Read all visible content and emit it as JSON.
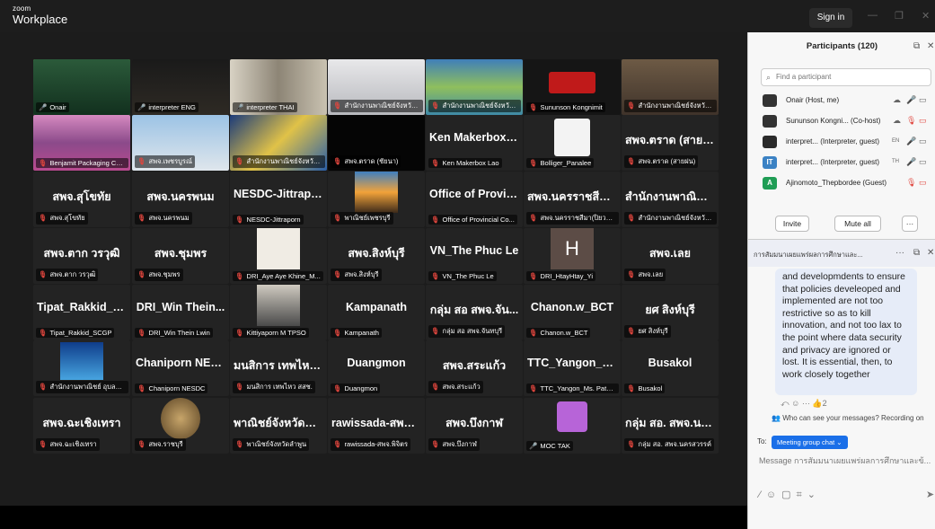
{
  "app": {
    "brand_small": "zoom",
    "brand_name": "Workplace",
    "signin": "Sign in"
  },
  "colors": {
    "active_speaker": "#7ac943",
    "muted": "#e0463e",
    "accent": "#1a6fe8"
  },
  "tiles": [
    {
      "big": "",
      "cap": "Onair",
      "muted": false,
      "pic": "speaker"
    },
    {
      "big": "",
      "cap": "interpreter ENG",
      "muted": false,
      "pic": "dark"
    },
    {
      "big": "",
      "cap": "interpreter THAI",
      "muted": false,
      "pic": "room"
    },
    {
      "big": "",
      "cap": "สำนักงานพาณิชย์จังหวัดสุ...",
      "muted": true,
      "pic": "office"
    },
    {
      "big": "",
      "cap": "สำนักงานพาณิชย์จังหวัดหน...",
      "muted": true,
      "pic": "landscape"
    },
    {
      "big": "",
      "cap": "Sununson Kongnimit",
      "muted": true,
      "pic": "logo"
    },
    {
      "big": "",
      "cap": "สำนักงานพาณิชย์จังหวัดสุ...",
      "muted": true,
      "pic": "office2"
    },
    {
      "big": "",
      "cap": "Benjamit Packaging Co., Lt...",
      "muted": true,
      "pic": "flowers"
    },
    {
      "big": "",
      "cap": "สพจ.เพชรบูรณ์",
      "muted": true,
      "pic": "building"
    },
    {
      "big": "",
      "cap": "สำนักงานพาณิชย์จังหวัดประจวบ...",
      "muted": true,
      "pic": "starry"
    },
    {
      "big": "",
      "cap": "สพจ.ตราด (ชัยนา)",
      "muted": true,
      "pic": "black"
    },
    {
      "big": "Ken Makerbox L...",
      "cap": "Ken Makerbox Lao",
      "muted": true,
      "pic": ""
    },
    {
      "big": "",
      "cap": "Bolliger_Panalee",
      "muted": true,
      "pic": "woman"
    },
    {
      "big": "สพจ.ตราด (สายฝน)",
      "cap": "สพจ.ตราด (สายฝน)",
      "muted": true,
      "pic": ""
    },
    {
      "big": "สพจ.สุโขทัย",
      "cap": "สพจ.สุโขทัย",
      "muted": true,
      "pic": ""
    },
    {
      "big": "สพจ.นครพนม",
      "cap": "สพจ.นครพนม",
      "muted": true,
      "pic": ""
    },
    {
      "big": "NESDC-Jittraporn",
      "cap": "NESDC-Jittraporn",
      "muted": true,
      "pic": ""
    },
    {
      "big": "",
      "cap": "พาณิชย์เพชรบุรี",
      "muted": true,
      "pic": "sunset"
    },
    {
      "big": "Office of Provin...",
      "cap": "Office of Provincial Co...",
      "muted": true,
      "pic": ""
    },
    {
      "big": "สพจ.นครราชสีมา...",
      "cap": "สพจ.นครราชสีมา(ปิยวรรณ)",
      "muted": true,
      "pic": ""
    },
    {
      "big": "สำนักงานพาณิชย์...",
      "cap": "สำนักงานพาณิชย์จังหวัด...",
      "muted": true,
      "pic": ""
    },
    {
      "big": "สพจ.ตาก วรวุฒิ",
      "cap": "สพจ.ตาก วรวุฒิ",
      "muted": true,
      "pic": ""
    },
    {
      "big": "สพจ.ชุมพร",
      "cap": "สพจ.ชุมพร",
      "muted": true,
      "pic": ""
    },
    {
      "big": "",
      "cap": "DRI_Aye Aye Khine_M...",
      "muted": true,
      "pic": "plant"
    },
    {
      "big": "สพจ.สิงห์บุรี",
      "cap": "สพจ.สิงห์บุรี",
      "muted": true,
      "pic": ""
    },
    {
      "big": "VN_The Phuc Le",
      "cap": "VN_The Phuc Le",
      "muted": true,
      "pic": ""
    },
    {
      "big": "",
      "cap": "DRI_HtayHtay_Yi",
      "muted": true,
      "pic": "avatarH"
    },
    {
      "big": "สพจ.เลย",
      "cap": "สพจ.เลย",
      "muted": true,
      "pic": ""
    },
    {
      "big": "Tipat_Rakkid_SC...",
      "cap": "Tipat_Rakkid_SCGP",
      "muted": true,
      "pic": ""
    },
    {
      "big": "DRI_Win Thein...",
      "cap": "DRI_Win Thein Lwin",
      "muted": true,
      "pic": ""
    },
    {
      "big": "",
      "cap": "Kittiyaporn M TPSO",
      "muted": true,
      "pic": "person"
    },
    {
      "big": "Kampanath",
      "cap": "Kampanath",
      "muted": true,
      "pic": ""
    },
    {
      "big": "กลุ่ม สอ สพจ.จัน...",
      "cap": "กลุ่ม สอ สพจ.จันทบุรี",
      "muted": true,
      "pic": ""
    },
    {
      "big": "Chanon.w_BCT",
      "cap": "Chanon.w_BCT",
      "muted": true,
      "pic": ""
    },
    {
      "big": "ยศ สิงห์บุรี",
      "cap": "ยศ สิงห์บุรี",
      "muted": true,
      "pic": ""
    },
    {
      "big": "",
      "cap": "สำนักงานพาณิชย์ อุบลราชธานี",
      "muted": true,
      "pic": "emblem"
    },
    {
      "big": "Chaniporn NESDC",
      "cap": "Chaniporn NESDC",
      "muted": true,
      "pic": ""
    },
    {
      "big": "มนสิการ เทพไหว...",
      "cap": "มนสิการ เทพไหว สสช.",
      "muted": true,
      "pic": ""
    },
    {
      "big": "Duangmon",
      "cap": "Duangmon",
      "muted": true,
      "pic": ""
    },
    {
      "big": "สพจ.สระแก้ว",
      "cap": "สพจ.สระแก้ว",
      "muted": true,
      "pic": ""
    },
    {
      "big": "TTC_Yangon_Ms...",
      "cap": "TTC_Yangon_Ms. Patch...",
      "muted": true,
      "pic": ""
    },
    {
      "big": "Busakol",
      "cap": "Busakol",
      "muted": true,
      "pic": ""
    },
    {
      "big": "สพจ.ฉะเชิงเทรา",
      "cap": "สพจ.ฉะเชิงเทรา",
      "muted": true,
      "pic": ""
    },
    {
      "big": "",
      "cap": "สพจ.ราชบุรี",
      "muted": true,
      "pic": "seal"
    },
    {
      "big": "พาณิชย์จังหวัดลำ...",
      "cap": "พาณิชย์จังหวัดลำพูน",
      "muted": true,
      "pic": ""
    },
    {
      "big": "rawissada-สพจ....",
      "cap": "rawissada-สพจ.พิจิตร",
      "muted": true,
      "pic": ""
    },
    {
      "big": "สพจ.บึงกาฬ",
      "cap": "สพจ.บึงกาฬ",
      "muted": true,
      "pic": ""
    },
    {
      "big": "",
      "cap": "MOC TAK",
      "muted": false,
      "pic": "avatarP"
    },
    {
      "big": "กลุ่ม สอ. สพจ.นค...",
      "cap": "กลุ่ม สอ. สพจ.นครสวรรค์",
      "muted": true,
      "pic": ""
    }
  ],
  "participants": {
    "title": "Participants (120)",
    "search_placeholder": "Find a participant",
    "rows": [
      {
        "name": "Onair (Host, me)",
        "avatar": "",
        "color": "#333"
      },
      {
        "name": "Sununson Kongni... (Co-host)",
        "avatar": "",
        "color": "#333"
      },
      {
        "name": "interpret... (Interpreter, guest)",
        "badge": "EN",
        "avatar": "",
        "color": "#2a2a2a"
      },
      {
        "name": "interpret... (Interpreter, guest)",
        "badge": "TH",
        "avatar": "IT",
        "color": "#3b82c4"
      },
      {
        "name": "Ajinomoto_Thepbordee (Guest)",
        "avatar": "A",
        "color": "#1f9d55"
      }
    ],
    "invite": "Invite",
    "mute_all": "Mute all",
    "more": "···"
  },
  "chat": {
    "title": "การสัมมนาเผยแพร่ผลการศึกษาและ...",
    "message": "and developmdents to ensure that policies develeoped and implemented are not too restrictive so as to kill innovation, and not too lax to the point where data security and privacy are ignored or lost.  It is essential, then, to work closely together",
    "reaction_count": "2",
    "who_can_see": "Who can see your messages? Recording on",
    "to_label": "To:",
    "to_target": "Meeting group chat ⌄",
    "input_placeholder": "Message การสัมมนาเผยแพร่ผลการศึกษาและข้..."
  }
}
